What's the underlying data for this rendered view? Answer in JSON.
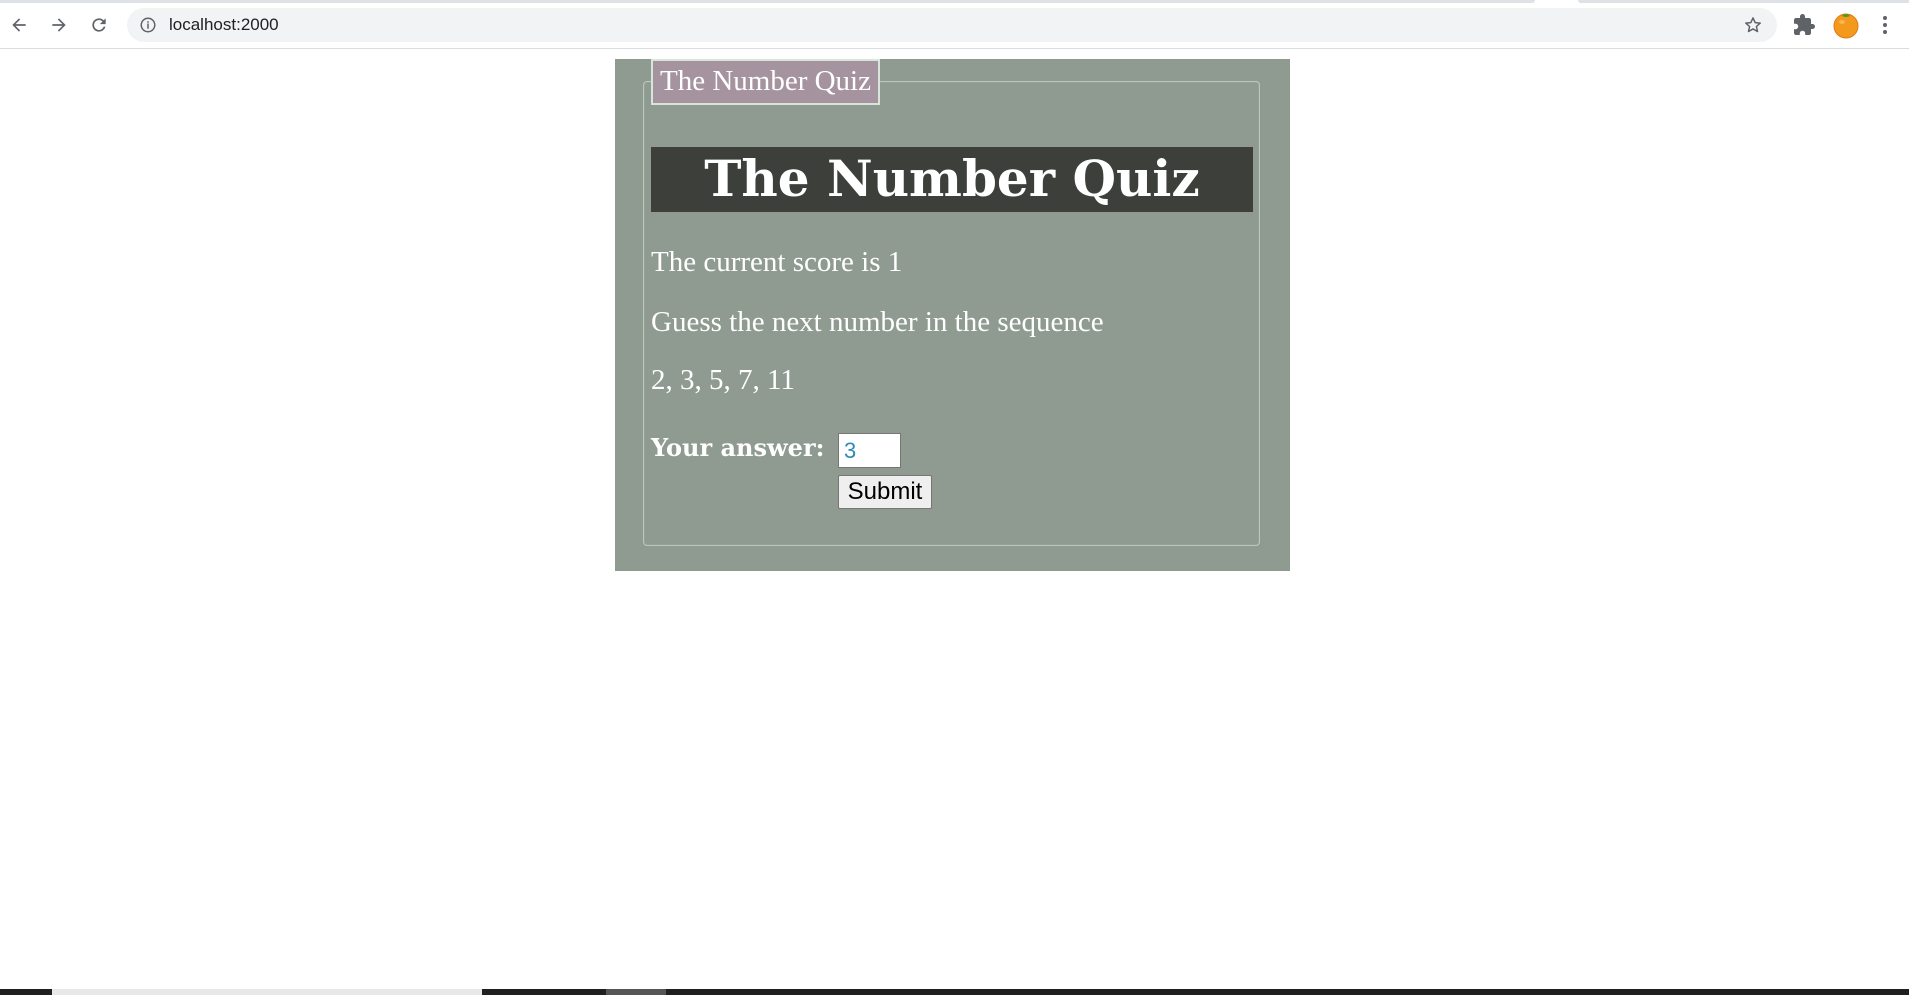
{
  "browser": {
    "url": "localhost:2000",
    "icons": {
      "back": "arrow-left-icon",
      "forward": "arrow-right-icon",
      "reload": "reload-icon",
      "info": "info-icon",
      "bookmark": "star-icon",
      "extensions": "puzzle-piece-icon",
      "profile": "orange-avatar",
      "menu": "kebab-menu-icon"
    }
  },
  "quiz": {
    "legend": "The Number Quiz",
    "heading": "The Number Quiz",
    "score_text": "The current score is 1",
    "prompt_text": "Guess the next number in the sequence",
    "sequence_text": "2, 3, 5, 7, 11",
    "answer_label": "Your answer:",
    "answer_value": "3",
    "submit_label": "Submit"
  },
  "colors": {
    "panel_bg": "#8f9a90",
    "legend_bg": "#a693a0",
    "heading_bg": "#3d3f3a",
    "text": "#ffffff",
    "input_text": "#2e8bb5"
  }
}
